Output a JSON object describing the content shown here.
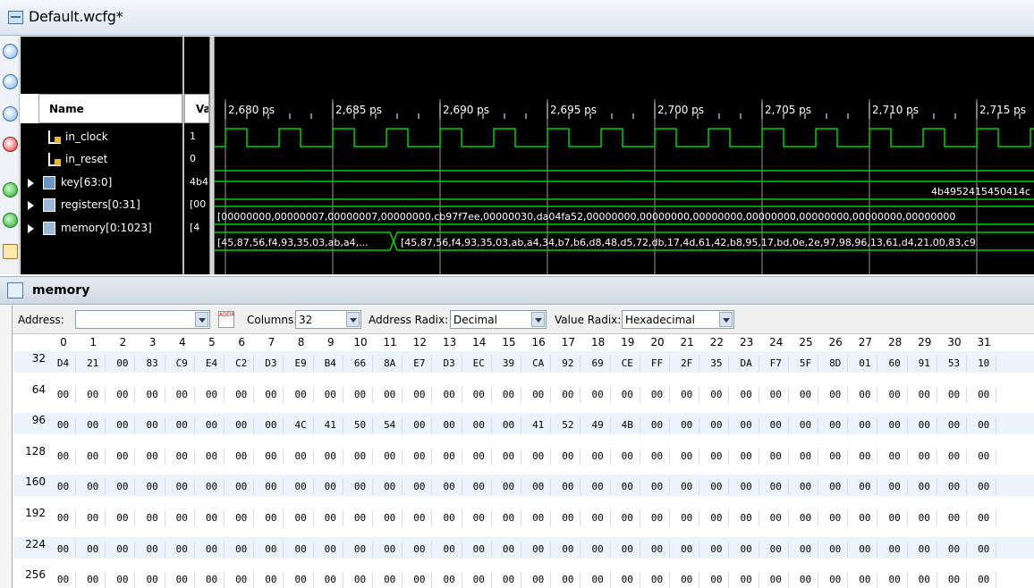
{
  "window": {
    "title": "Default.wcfg*"
  },
  "names": {
    "header": "Name",
    "signals": [
      {
        "label": "in_clock",
        "icon": "bit-signal-icon"
      },
      {
        "label": "in_reset",
        "icon": "bit-signal-icon"
      },
      {
        "label": "key[63:0]",
        "icon": "bus-signal-icon"
      },
      {
        "label": "registers[0:31]",
        "icon": "array-signal-icon"
      },
      {
        "label": "memory[0:1023]",
        "icon": "array-signal-icon"
      }
    ]
  },
  "values": {
    "header": "Va",
    "items": [
      "1",
      "0",
      "4b4",
      "[00",
      "[4"
    ]
  },
  "timeline": {
    "ticks": [
      "2,680 ps",
      "2,685 ps",
      "2,690 ps",
      "2,695 ps",
      "2,700 ps",
      "2,705 ps",
      "2,710 ps",
      "2,715 ps"
    ],
    "key_value": "4b4952415450414c",
    "registers_value": "[00000000,00000007,00000007,00000000,cb97f7ee,00000030,da04fa52,00000000,00000000,00000000,00000000,00000000,00000000,00000000",
    "memory_value_a": "[45,87,56,f4,93,35,03,ab,a4,...",
    "memory_value_b": "[45,87,56,f4,93,35,03,ab,a4,34,b7,b6,d8,48,d5,72,db,17,4d,61,42,b8,95,17,bd,0e,2e,97,98,96,13,61,d4,21,00,83,c9",
    "colors": {
      "wave": "#00d000",
      "background": "#000000"
    }
  },
  "memory": {
    "panel_title": "memory",
    "address_label": "Address:",
    "address_value": "",
    "columns_label": "Columns:",
    "columns_value": "32",
    "address_radix_label": "Address Radix:",
    "address_radix_value": "Decimal",
    "value_radix_label": "Value Radix:",
    "value_radix_value": "Hexadecimal",
    "addr_button": "ADDR",
    "col_headers": [
      "0",
      "1",
      "2",
      "3",
      "4",
      "5",
      "6",
      "7",
      "8",
      "9",
      "10",
      "11",
      "12",
      "13",
      "14",
      "15",
      "16",
      "17",
      "18",
      "19",
      "20",
      "21",
      "22",
      "23",
      "24",
      "25",
      "26",
      "27",
      "28",
      "29",
      "30",
      "31"
    ],
    "rows": [
      {
        "addr": "32",
        "cells": [
          "D4",
          "21",
          "00",
          "83",
          "C9",
          "E4",
          "C2",
          "D3",
          "E9",
          "B4",
          "66",
          "8A",
          "E7",
          "D3",
          "EC",
          "39",
          "CA",
          "92",
          "69",
          "CE",
          "FF",
          "2F",
          "35",
          "DA",
          "F7",
          "5F",
          "8D",
          "01",
          "60",
          "91",
          "53",
          "10"
        ]
      },
      {
        "addr": "64",
        "cells": [
          "00",
          "00",
          "00",
          "00",
          "00",
          "00",
          "00",
          "00",
          "00",
          "00",
          "00",
          "00",
          "00",
          "00",
          "00",
          "00",
          "00",
          "00",
          "00",
          "00",
          "00",
          "00",
          "00",
          "00",
          "00",
          "00",
          "00",
          "00",
          "00",
          "00",
          "00",
          "00"
        ]
      },
      {
        "addr": "96",
        "cells": [
          "00",
          "00",
          "00",
          "00",
          "00",
          "00",
          "00",
          "00",
          "4C",
          "41",
          "50",
          "54",
          "00",
          "00",
          "00",
          "00",
          "41",
          "52",
          "49",
          "4B",
          "00",
          "00",
          "00",
          "00",
          "00",
          "00",
          "00",
          "00",
          "00",
          "00",
          "00",
          "00"
        ]
      },
      {
        "addr": "128",
        "cells": [
          "00",
          "00",
          "00",
          "00",
          "00",
          "00",
          "00",
          "00",
          "00",
          "00",
          "00",
          "00",
          "00",
          "00",
          "00",
          "00",
          "00",
          "00",
          "00",
          "00",
          "00",
          "00",
          "00",
          "00",
          "00",
          "00",
          "00",
          "00",
          "00",
          "00",
          "00",
          "00"
        ]
      },
      {
        "addr": "160",
        "cells": [
          "00",
          "00",
          "00",
          "00",
          "00",
          "00",
          "00",
          "00",
          "00",
          "00",
          "00",
          "00",
          "00",
          "00",
          "00",
          "00",
          "00",
          "00",
          "00",
          "00",
          "00",
          "00",
          "00",
          "00",
          "00",
          "00",
          "00",
          "00",
          "00",
          "00",
          "00",
          "00"
        ]
      },
      {
        "addr": "192",
        "cells": [
          "00",
          "00",
          "00",
          "00",
          "00",
          "00",
          "00",
          "00",
          "00",
          "00",
          "00",
          "00",
          "00",
          "00",
          "00",
          "00",
          "00",
          "00",
          "00",
          "00",
          "00",
          "00",
          "00",
          "00",
          "00",
          "00",
          "00",
          "00",
          "00",
          "00",
          "00",
          "00"
        ]
      },
      {
        "addr": "224",
        "cells": [
          "00",
          "00",
          "00",
          "00",
          "00",
          "00",
          "00",
          "00",
          "00",
          "00",
          "00",
          "00",
          "00",
          "00",
          "00",
          "00",
          "00",
          "00",
          "00",
          "00",
          "00",
          "00",
          "00",
          "00",
          "00",
          "00",
          "00",
          "00",
          "00",
          "00",
          "00",
          "00"
        ]
      },
      {
        "addr": "256",
        "cells": [
          "00",
          "00",
          "00",
          "00",
          "00",
          "00",
          "00",
          "00",
          "00",
          "00",
          "00",
          "00",
          "00",
          "00",
          "00",
          "00",
          "00",
          "00",
          "00",
          "00",
          "00",
          "00",
          "00",
          "00",
          "00",
          "00",
          "00",
          "00",
          "00",
          "00",
          "00",
          "00"
        ]
      }
    ]
  },
  "toolbar_icons": [
    "zoom-in-icon",
    "zoom-out-icon",
    "zoom-fit-icon",
    "zoom-cursor-icon",
    "go-to-start-icon",
    "go-to-end-icon",
    "swap-cursor-icon"
  ]
}
